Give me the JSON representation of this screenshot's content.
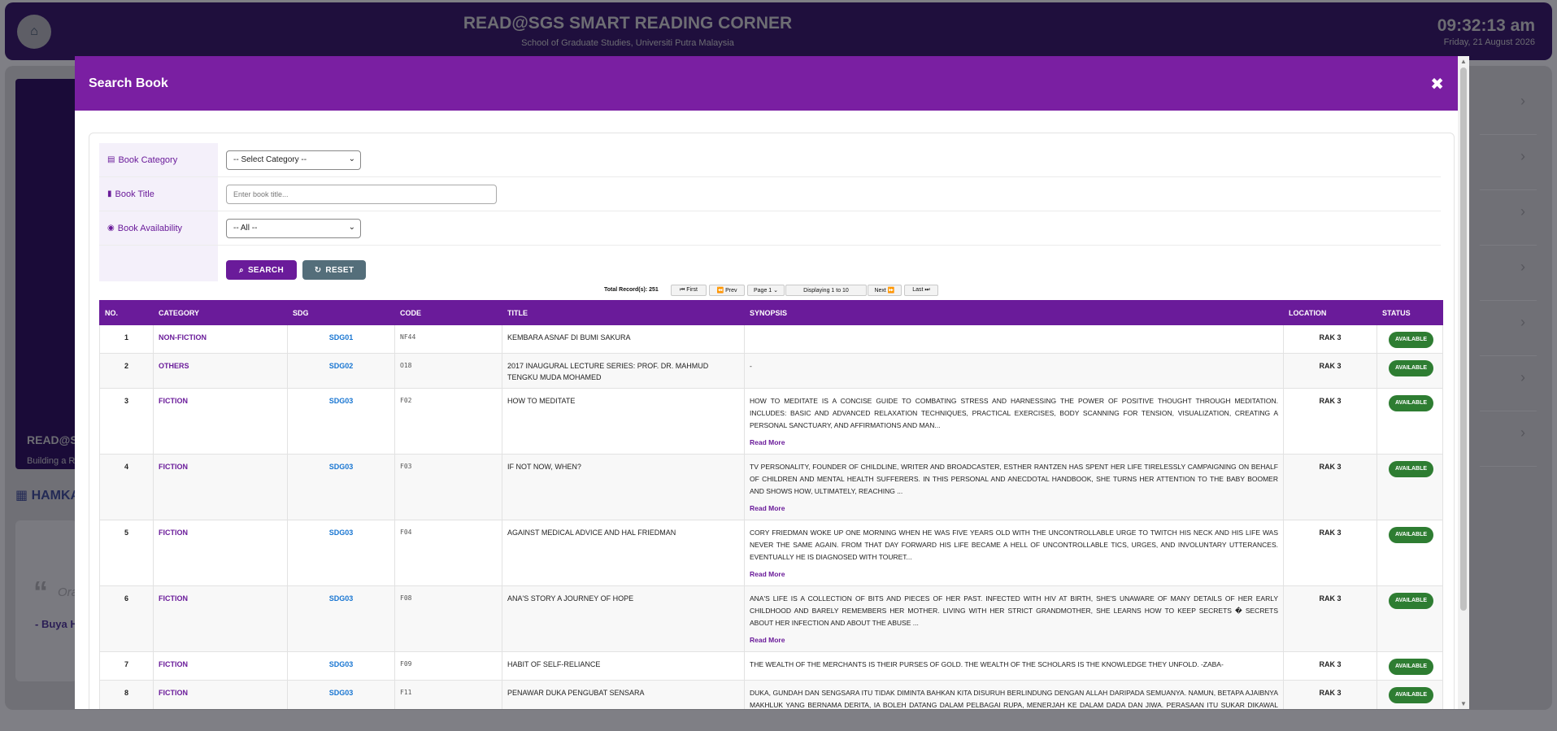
{
  "app": {
    "title": "READ@SGS SMART READING CORNER",
    "subtitle": "School of Graduate Studies, Universiti Putra Malaysia",
    "clock": "09:32:13 am",
    "date": "Friday, 21 August 2026",
    "hero_title": "READ@SG",
    "hero_sub": "Building a Re",
    "section_title": "HAMKA",
    "quote_text": "Ora",
    "quote_author": "- Buya H"
  },
  "modal": {
    "title": "Search Book",
    "close_icon": "close-icon"
  },
  "form": {
    "category_label": "Book Category",
    "category_value": "-- Select Category --",
    "title_label": "Book Title",
    "title_placeholder": "Enter book title...",
    "availability_label": "Book Availability",
    "availability_value": "-- All --",
    "search_label": "SEARCH",
    "reset_label": "RESET"
  },
  "pager": {
    "total": "Total Record(s): 251",
    "first": "⏮ First",
    "prev": "⏪ Prev",
    "page": "Page 1",
    "display": "Displaying 1 to 10",
    "next": "Next ⏩",
    "last": "Last ⏭"
  },
  "table": {
    "headers": [
      "NO.",
      "CATEGORY",
      "SDG",
      "CODE",
      "TITLE",
      "SYNOPSIS",
      "LOCATION",
      "STATUS"
    ],
    "read_more": "Read More",
    "rows": [
      {
        "no": "1",
        "category": "NON-FICTION",
        "sdg": "SDG01",
        "code": "NF44",
        "title": "KEMBARA ASNAF DI BUMI SAKURA",
        "synopsis": "",
        "more": false,
        "location": "RAK 3",
        "status": "AVAILABLE"
      },
      {
        "no": "2",
        "category": "OTHERS",
        "sdg": "SDG02",
        "code": "O18",
        "title": "2017 INAUGURAL LECTURE SERIES: PROF. DR. MAHMUD TENGKU MUDA MOHAMED",
        "synopsis": "-",
        "more": false,
        "location": "RAK 3",
        "status": "AVAILABLE"
      },
      {
        "no": "3",
        "category": "FICTION",
        "sdg": "SDG03",
        "code": "F02",
        "title": "HOW TO MEDITATE",
        "synopsis": "HOW TO MEDITATE IS A CONCISE GUIDE TO COMBATING STRESS AND HARNESSING THE POWER OF POSITIVE THOUGHT THROUGH MEDITATION. INCLUDES: BASIC AND ADVANCED RELAXATION TECHNIQUES, PRACTICAL EXERCISES, BODY SCANNING FOR TENSION, VISUALIZATION, CREATING A PERSONAL SANCTUARY, AND AFFIRMATIONS AND MAN...",
        "more": true,
        "location": "RAK 3",
        "status": "AVAILABLE"
      },
      {
        "no": "4",
        "category": "FICTION",
        "sdg": "SDG03",
        "code": "F03",
        "title": "IF NOT NOW, WHEN?",
        "synopsis": "TV PERSONALITY, FOUNDER OF CHILDLINE, WRITER AND BROADCASTER, ESTHER RANTZEN HAS SPENT HER LIFE TIRELESSLY CAMPAIGNING ON BEHALF OF CHILDREN AND MENTAL HEALTH SUFFERERS. IN THIS PERSONAL AND ANECDOTAL HANDBOOK, SHE TURNS HER ATTENTION TO THE BABY BOOMER AND SHOWS HOW, ULTIMATELY, REACHING ...",
        "more": true,
        "location": "RAK 3",
        "status": "AVAILABLE"
      },
      {
        "no": "5",
        "category": "FICTION",
        "sdg": "SDG03",
        "code": "F04",
        "title": "AGAINST MEDICAL ADVICE AND HAL FRIEDMAN",
        "synopsis": "CORY FRIEDMAN WOKE UP ONE MORNING WHEN HE WAS FIVE YEARS OLD WITH THE UNCONTROLLABLE URGE TO TWITCH HIS NECK AND HIS LIFE WAS NEVER THE SAME AGAIN. FROM THAT DAY FORWARD HIS LIFE BECAME A HELL OF UNCONTROLLABLE TICS, URGES, AND INVOLUNTARY UTTERANCES. EVENTUALLY HE IS DIAGNOSED WITH TOURET...",
        "more": true,
        "location": "RAK 3",
        "status": "AVAILABLE"
      },
      {
        "no": "6",
        "category": "FICTION",
        "sdg": "SDG03",
        "code": "F08",
        "title": "ANA'S STORY A JOURNEY OF HOPE",
        "synopsis": "ANA'S LIFE IS A COLLECTION OF BITS AND PIECES OF HER PAST. INFECTED WITH HIV AT BIRTH, SHE'S UNAWARE OF MANY DETAILS OF HER EARLY CHILDHOOD AND BARELY REMEMBERS HER MOTHER. LIVING WITH HER STRICT GRANDMOTHER, SHE LEARNS HOW TO KEEP SECRETS � SECRETS ABOUT HER INFECTION AND ABOUT THE ABUSE ...",
        "more": true,
        "location": "RAK 3",
        "status": "AVAILABLE"
      },
      {
        "no": "7",
        "category": "FICTION",
        "sdg": "SDG03",
        "code": "F09",
        "title": "HABIT OF SELF-RELIANCE",
        "synopsis": "THE WEALTH OF THE MERCHANTS IS THEIR PURSES OF GOLD. THE WEALTH OF THE SCHOLARS IS THE KNOWLEDGE THEY UNFOLD. -ZABA-",
        "more": false,
        "location": "RAK 3",
        "status": "AVAILABLE"
      },
      {
        "no": "8",
        "category": "FICTION",
        "sdg": "SDG03",
        "code": "F11",
        "title": "PENAWAR DUKA PENGUBAT SENSARA",
        "synopsis": "DUKA, GUNDAH DAN SENGSARA ITU TIDAK DIMINTA BAHKAN KITA DISURUH BERLINDUNG DENGAN ALLAH DARIPADA SEMUANYA. NAMUN, BETAPA AJAIBNYA MAKHLUK YANG BERNAMA DERITA, IA BOLEH DATANG DALAM PELBAGAI RUPA, MENERJAH KE DALAM DADA DAN JIWA. PERASAAN ITU SUKAR DIKAWAL BAHKAN ADAKALA KITA SUKAR MENGERTI...",
        "more": false,
        "location": "RAK 3",
        "status": "AVAILABLE"
      }
    ]
  },
  "colors": {
    "accent": "#7a1fa2",
    "header": "#6a1b9a",
    "available": "#2e7d32",
    "sdg_link": "#1976d2"
  }
}
